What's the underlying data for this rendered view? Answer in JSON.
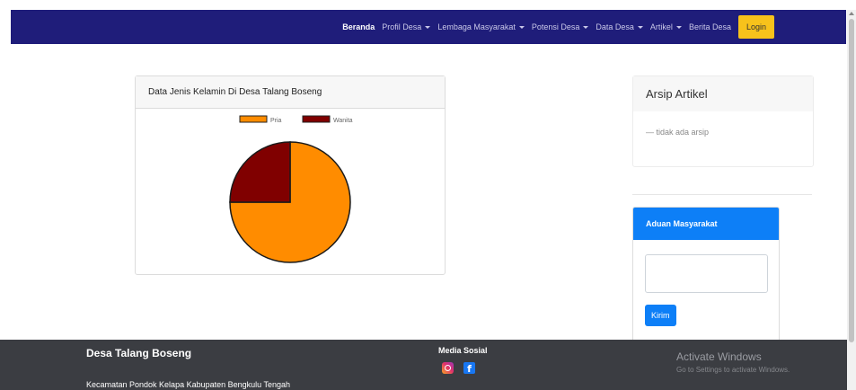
{
  "navbar": {
    "items": [
      {
        "label": "Beranda",
        "dropdown": false,
        "active": true
      },
      {
        "label": "Profil Desa",
        "dropdown": true
      },
      {
        "label": "Lembaga Masyarakat",
        "dropdown": true
      },
      {
        "label": "Potensi Desa",
        "dropdown": true
      },
      {
        "label": "Data Desa",
        "dropdown": true
      },
      {
        "label": "Artikel",
        "dropdown": true
      },
      {
        "label": "Berita Desa",
        "dropdown": false
      }
    ],
    "login_label": "Login",
    "bg_color": "#1f1d7a",
    "login_color": "#f7c21b"
  },
  "chart_card": {
    "title": "Data Jenis Kelamin Di Desa Talang Boseng"
  },
  "chart_data": {
    "type": "pie",
    "title": "",
    "legend_position": "top",
    "slices": [
      {
        "label": "Pria",
        "value": 75,
        "color": "#ff8c00"
      },
      {
        "label": "Wanita",
        "value": 25,
        "color": "#800000"
      }
    ]
  },
  "archive": {
    "title": "Arsip Artikel",
    "empty_text": "— tidak ada arsip"
  },
  "complaint": {
    "title": "Aduan Masyarakat",
    "textarea_value": "",
    "send_label": "Kirim",
    "accent": "#0d7ff7"
  },
  "footer": {
    "title": "Desa Talang Boseng",
    "address": "Kecamatan Pondok Kelapa Kabupaten Bengkulu Tengah",
    "social_title": "Media Sosial",
    "social_icons": [
      "instagram-icon",
      "facebook-icon"
    ]
  },
  "watermark": {
    "title": "Activate Windows",
    "subtitle": "Go to Settings to activate Windows."
  }
}
